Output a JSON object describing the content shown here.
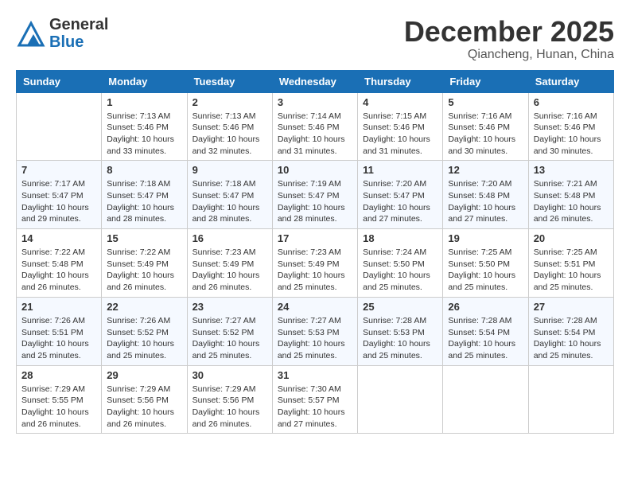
{
  "header": {
    "logo_line1": "General",
    "logo_line2": "Blue",
    "month": "December 2025",
    "location": "Qiancheng, Hunan, China"
  },
  "weekdays": [
    "Sunday",
    "Monday",
    "Tuesday",
    "Wednesday",
    "Thursday",
    "Friday",
    "Saturday"
  ],
  "weeks": [
    [
      {
        "day": "",
        "info": ""
      },
      {
        "day": "1",
        "info": "Sunrise: 7:13 AM\nSunset: 5:46 PM\nDaylight: 10 hours\nand 33 minutes."
      },
      {
        "day": "2",
        "info": "Sunrise: 7:13 AM\nSunset: 5:46 PM\nDaylight: 10 hours\nand 32 minutes."
      },
      {
        "day": "3",
        "info": "Sunrise: 7:14 AM\nSunset: 5:46 PM\nDaylight: 10 hours\nand 31 minutes."
      },
      {
        "day": "4",
        "info": "Sunrise: 7:15 AM\nSunset: 5:46 PM\nDaylight: 10 hours\nand 31 minutes."
      },
      {
        "day": "5",
        "info": "Sunrise: 7:16 AM\nSunset: 5:46 PM\nDaylight: 10 hours\nand 30 minutes."
      },
      {
        "day": "6",
        "info": "Sunrise: 7:16 AM\nSunset: 5:46 PM\nDaylight: 10 hours\nand 30 minutes."
      }
    ],
    [
      {
        "day": "7",
        "info": "Sunrise: 7:17 AM\nSunset: 5:47 PM\nDaylight: 10 hours\nand 29 minutes."
      },
      {
        "day": "8",
        "info": "Sunrise: 7:18 AM\nSunset: 5:47 PM\nDaylight: 10 hours\nand 28 minutes."
      },
      {
        "day": "9",
        "info": "Sunrise: 7:18 AM\nSunset: 5:47 PM\nDaylight: 10 hours\nand 28 minutes."
      },
      {
        "day": "10",
        "info": "Sunrise: 7:19 AM\nSunset: 5:47 PM\nDaylight: 10 hours\nand 28 minutes."
      },
      {
        "day": "11",
        "info": "Sunrise: 7:20 AM\nSunset: 5:47 PM\nDaylight: 10 hours\nand 27 minutes."
      },
      {
        "day": "12",
        "info": "Sunrise: 7:20 AM\nSunset: 5:48 PM\nDaylight: 10 hours\nand 27 minutes."
      },
      {
        "day": "13",
        "info": "Sunrise: 7:21 AM\nSunset: 5:48 PM\nDaylight: 10 hours\nand 26 minutes."
      }
    ],
    [
      {
        "day": "14",
        "info": "Sunrise: 7:22 AM\nSunset: 5:48 PM\nDaylight: 10 hours\nand 26 minutes."
      },
      {
        "day": "15",
        "info": "Sunrise: 7:22 AM\nSunset: 5:49 PM\nDaylight: 10 hours\nand 26 minutes."
      },
      {
        "day": "16",
        "info": "Sunrise: 7:23 AM\nSunset: 5:49 PM\nDaylight: 10 hours\nand 26 minutes."
      },
      {
        "day": "17",
        "info": "Sunrise: 7:23 AM\nSunset: 5:49 PM\nDaylight: 10 hours\nand 25 minutes."
      },
      {
        "day": "18",
        "info": "Sunrise: 7:24 AM\nSunset: 5:50 PM\nDaylight: 10 hours\nand 25 minutes."
      },
      {
        "day": "19",
        "info": "Sunrise: 7:25 AM\nSunset: 5:50 PM\nDaylight: 10 hours\nand 25 minutes."
      },
      {
        "day": "20",
        "info": "Sunrise: 7:25 AM\nSunset: 5:51 PM\nDaylight: 10 hours\nand 25 minutes."
      }
    ],
    [
      {
        "day": "21",
        "info": "Sunrise: 7:26 AM\nSunset: 5:51 PM\nDaylight: 10 hours\nand 25 minutes."
      },
      {
        "day": "22",
        "info": "Sunrise: 7:26 AM\nSunset: 5:52 PM\nDaylight: 10 hours\nand 25 minutes."
      },
      {
        "day": "23",
        "info": "Sunrise: 7:27 AM\nSunset: 5:52 PM\nDaylight: 10 hours\nand 25 minutes."
      },
      {
        "day": "24",
        "info": "Sunrise: 7:27 AM\nSunset: 5:53 PM\nDaylight: 10 hours\nand 25 minutes."
      },
      {
        "day": "25",
        "info": "Sunrise: 7:28 AM\nSunset: 5:53 PM\nDaylight: 10 hours\nand 25 minutes."
      },
      {
        "day": "26",
        "info": "Sunrise: 7:28 AM\nSunset: 5:54 PM\nDaylight: 10 hours\nand 25 minutes."
      },
      {
        "day": "27",
        "info": "Sunrise: 7:28 AM\nSunset: 5:54 PM\nDaylight: 10 hours\nand 25 minutes."
      }
    ],
    [
      {
        "day": "28",
        "info": "Sunrise: 7:29 AM\nSunset: 5:55 PM\nDaylight: 10 hours\nand 26 minutes."
      },
      {
        "day": "29",
        "info": "Sunrise: 7:29 AM\nSunset: 5:56 PM\nDaylight: 10 hours\nand 26 minutes."
      },
      {
        "day": "30",
        "info": "Sunrise: 7:29 AM\nSunset: 5:56 PM\nDaylight: 10 hours\nand 26 minutes."
      },
      {
        "day": "31",
        "info": "Sunrise: 7:30 AM\nSunset: 5:57 PM\nDaylight: 10 hours\nand 27 minutes."
      },
      {
        "day": "",
        "info": ""
      },
      {
        "day": "",
        "info": ""
      },
      {
        "day": "",
        "info": ""
      }
    ]
  ]
}
